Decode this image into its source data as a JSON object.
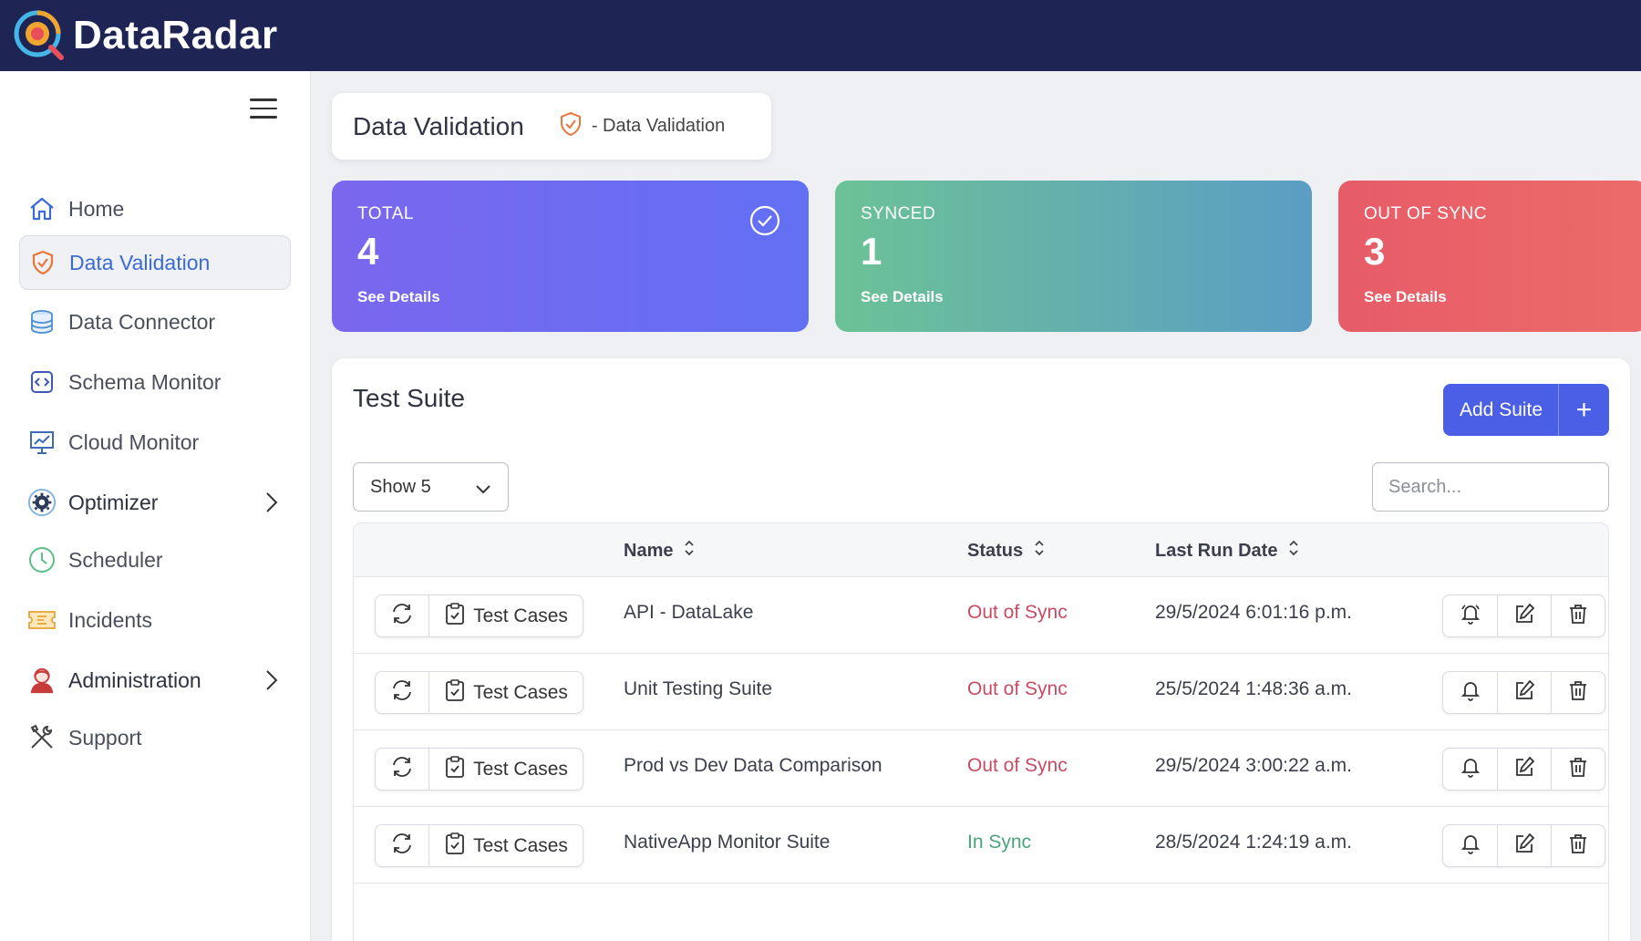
{
  "app": {
    "name": "DataRadar"
  },
  "sidebar": {
    "items": [
      {
        "label": "Home",
        "icon": "home-icon"
      },
      {
        "label": "Data Validation",
        "icon": "shield-check-icon",
        "active": true
      },
      {
        "label": "Data Connector",
        "icon": "database-icon"
      },
      {
        "label": "Schema Monitor",
        "icon": "code-icon"
      },
      {
        "label": "Cloud Monitor",
        "icon": "chart-board-icon"
      },
      {
        "label": "Optimizer",
        "icon": "gear-icon",
        "has_submenu": true
      },
      {
        "label": "Scheduler",
        "icon": "clock-icon"
      },
      {
        "label": "Incidents",
        "icon": "ticket-icon"
      },
      {
        "label": "Administration",
        "icon": "admin-user-icon",
        "has_submenu": true
      },
      {
        "label": "Support",
        "icon": "tools-icon"
      }
    ]
  },
  "header": {
    "title": "Data Validation",
    "breadcrumb": "- Data Validation"
  },
  "stats": {
    "total": {
      "label": "TOTAL",
      "value": "4",
      "link": "See Details"
    },
    "synced": {
      "label": "SYNCED",
      "value": "1",
      "link": "See Details"
    },
    "out_of_sync": {
      "label": "OUT OF SYNC",
      "value": "3",
      "link": "See Details"
    }
  },
  "suite": {
    "title": "Test Suite",
    "add_label": "Add Suite",
    "add_icon": "+",
    "show_value": "Show 5",
    "search_placeholder": "Search...",
    "columns": {
      "name": "Name",
      "status": "Status",
      "last_run": "Last Run Date"
    },
    "test_cases_label": "Test Cases",
    "rows": [
      {
        "name": "API - DataLake",
        "status": "Out of Sync",
        "last_run": "29/5/2024 6:01:16 p.m."
      },
      {
        "name": "Unit Testing Suite",
        "status": "Out of Sync",
        "last_run": "25/5/2024 1:48:36 a.m."
      },
      {
        "name": "Prod vs Dev Data Comparison",
        "status": "Out of Sync",
        "last_run": "29/5/2024 3:00:22 a.m."
      },
      {
        "name": "NativeApp Monitor Suite",
        "status": "In Sync",
        "last_run": "28/5/2024 1:24:19 a.m."
      }
    ]
  },
  "colors": {
    "topbar": "#1e2555",
    "accent": "#4a5ee6",
    "out_of_sync": "#c94a63",
    "in_sync": "#4aa37a"
  }
}
